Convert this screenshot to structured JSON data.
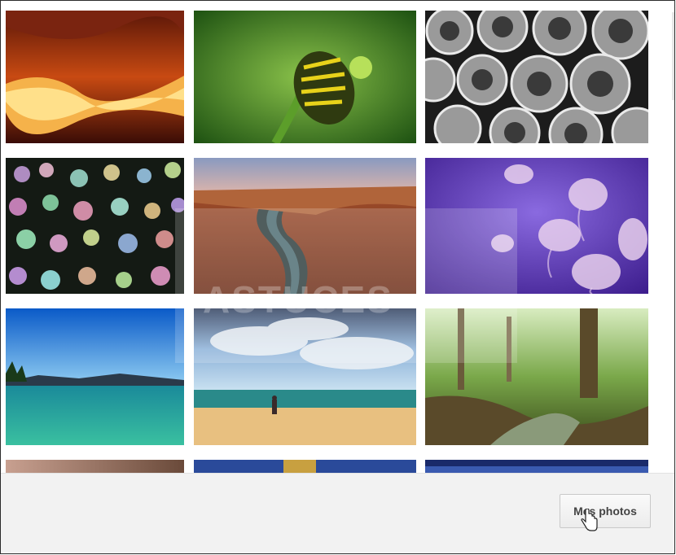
{
  "gallery": {
    "tiles": [
      {
        "subject": "red sandstone canyon"
      },
      {
        "subject": "caterpillar on green plant"
      },
      {
        "subject": "stacked metal pipes"
      },
      {
        "subject": "colorful bokeh lights"
      },
      {
        "subject": "canyon river bend"
      },
      {
        "subject": "purple jellyfish"
      },
      {
        "subject": "turquoise lake shore"
      },
      {
        "subject": "beach with clouds"
      },
      {
        "subject": "forest stream"
      }
    ]
  },
  "watermark": {
    "text": "ASTUCES"
  },
  "footer": {
    "button_label": "Mes photos"
  },
  "icons": {
    "cursor": "hand-pointer-icon"
  }
}
